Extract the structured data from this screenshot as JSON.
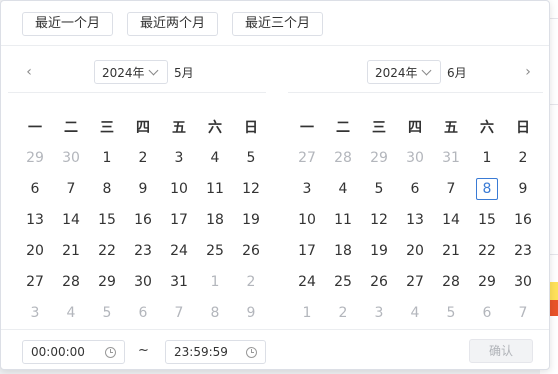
{
  "shortcuts": [
    "最近一个月",
    "最近两个月",
    "最近三个月"
  ],
  "left_panel": {
    "year": "2024年",
    "month": "5月",
    "prev_icon": "chevron-left-icon"
  },
  "right_panel": {
    "year": "2024年",
    "month": "6月",
    "next_icon": "chevron-right-icon"
  },
  "weekdays": [
    "一",
    "二",
    "三",
    "四",
    "五",
    "六",
    "日"
  ],
  "left_days": [
    [
      {
        "d": "29",
        "o": true
      },
      {
        "d": "30",
        "o": true
      },
      {
        "d": "1"
      },
      {
        "d": "2"
      },
      {
        "d": "3"
      },
      {
        "d": "4"
      },
      {
        "d": "5"
      }
    ],
    [
      {
        "d": "6"
      },
      {
        "d": "7"
      },
      {
        "d": "8"
      },
      {
        "d": "9"
      },
      {
        "d": "10"
      },
      {
        "d": "11"
      },
      {
        "d": "12"
      }
    ],
    [
      {
        "d": "13"
      },
      {
        "d": "14"
      },
      {
        "d": "15"
      },
      {
        "d": "16"
      },
      {
        "d": "17"
      },
      {
        "d": "18"
      },
      {
        "d": "19"
      }
    ],
    [
      {
        "d": "20"
      },
      {
        "d": "21"
      },
      {
        "d": "22"
      },
      {
        "d": "23"
      },
      {
        "d": "24"
      },
      {
        "d": "25"
      },
      {
        "d": "26"
      }
    ],
    [
      {
        "d": "27"
      },
      {
        "d": "28"
      },
      {
        "d": "29"
      },
      {
        "d": "30"
      },
      {
        "d": "31"
      },
      {
        "d": "1",
        "o": true
      },
      {
        "d": "2",
        "o": true
      }
    ],
    [
      {
        "d": "3",
        "o": true
      },
      {
        "d": "4",
        "o": true
      },
      {
        "d": "5",
        "o": true
      },
      {
        "d": "6",
        "o": true
      },
      {
        "d": "7",
        "o": true
      },
      {
        "d": "8",
        "o": true
      },
      {
        "d": "9",
        "o": true
      }
    ]
  ],
  "right_days": [
    [
      {
        "d": "27",
        "o": true
      },
      {
        "d": "28",
        "o": true
      },
      {
        "d": "29",
        "o": true
      },
      {
        "d": "30",
        "o": true
      },
      {
        "d": "31",
        "o": true
      },
      {
        "d": "1"
      },
      {
        "d": "2"
      }
    ],
    [
      {
        "d": "3"
      },
      {
        "d": "4"
      },
      {
        "d": "5"
      },
      {
        "d": "6"
      },
      {
        "d": "7"
      },
      {
        "d": "8",
        "today": true
      },
      {
        "d": "9"
      }
    ],
    [
      {
        "d": "10"
      },
      {
        "d": "11"
      },
      {
        "d": "12"
      },
      {
        "d": "13"
      },
      {
        "d": "14"
      },
      {
        "d": "15"
      },
      {
        "d": "16"
      }
    ],
    [
      {
        "d": "17"
      },
      {
        "d": "18"
      },
      {
        "d": "19"
      },
      {
        "d": "20"
      },
      {
        "d": "21"
      },
      {
        "d": "22"
      },
      {
        "d": "23"
      }
    ],
    [
      {
        "d": "24"
      },
      {
        "d": "25"
      },
      {
        "d": "26"
      },
      {
        "d": "27"
      },
      {
        "d": "28"
      },
      {
        "d": "29"
      },
      {
        "d": "30"
      }
    ],
    [
      {
        "d": "1",
        "o": true
      },
      {
        "d": "2",
        "o": true
      },
      {
        "d": "3",
        "o": true
      },
      {
        "d": "4",
        "o": true
      },
      {
        "d": "5",
        "o": true
      },
      {
        "d": "6",
        "o": true
      },
      {
        "d": "7",
        "o": true
      }
    ]
  ],
  "footer": {
    "start_time": "00:00:00",
    "end_time": "23:59:59",
    "separator": "~",
    "confirm_label": "确认"
  },
  "colors": {
    "accent": "#3a7bd5",
    "muted_text": "#b3b6bc",
    "border": "#dcdfe6"
  }
}
